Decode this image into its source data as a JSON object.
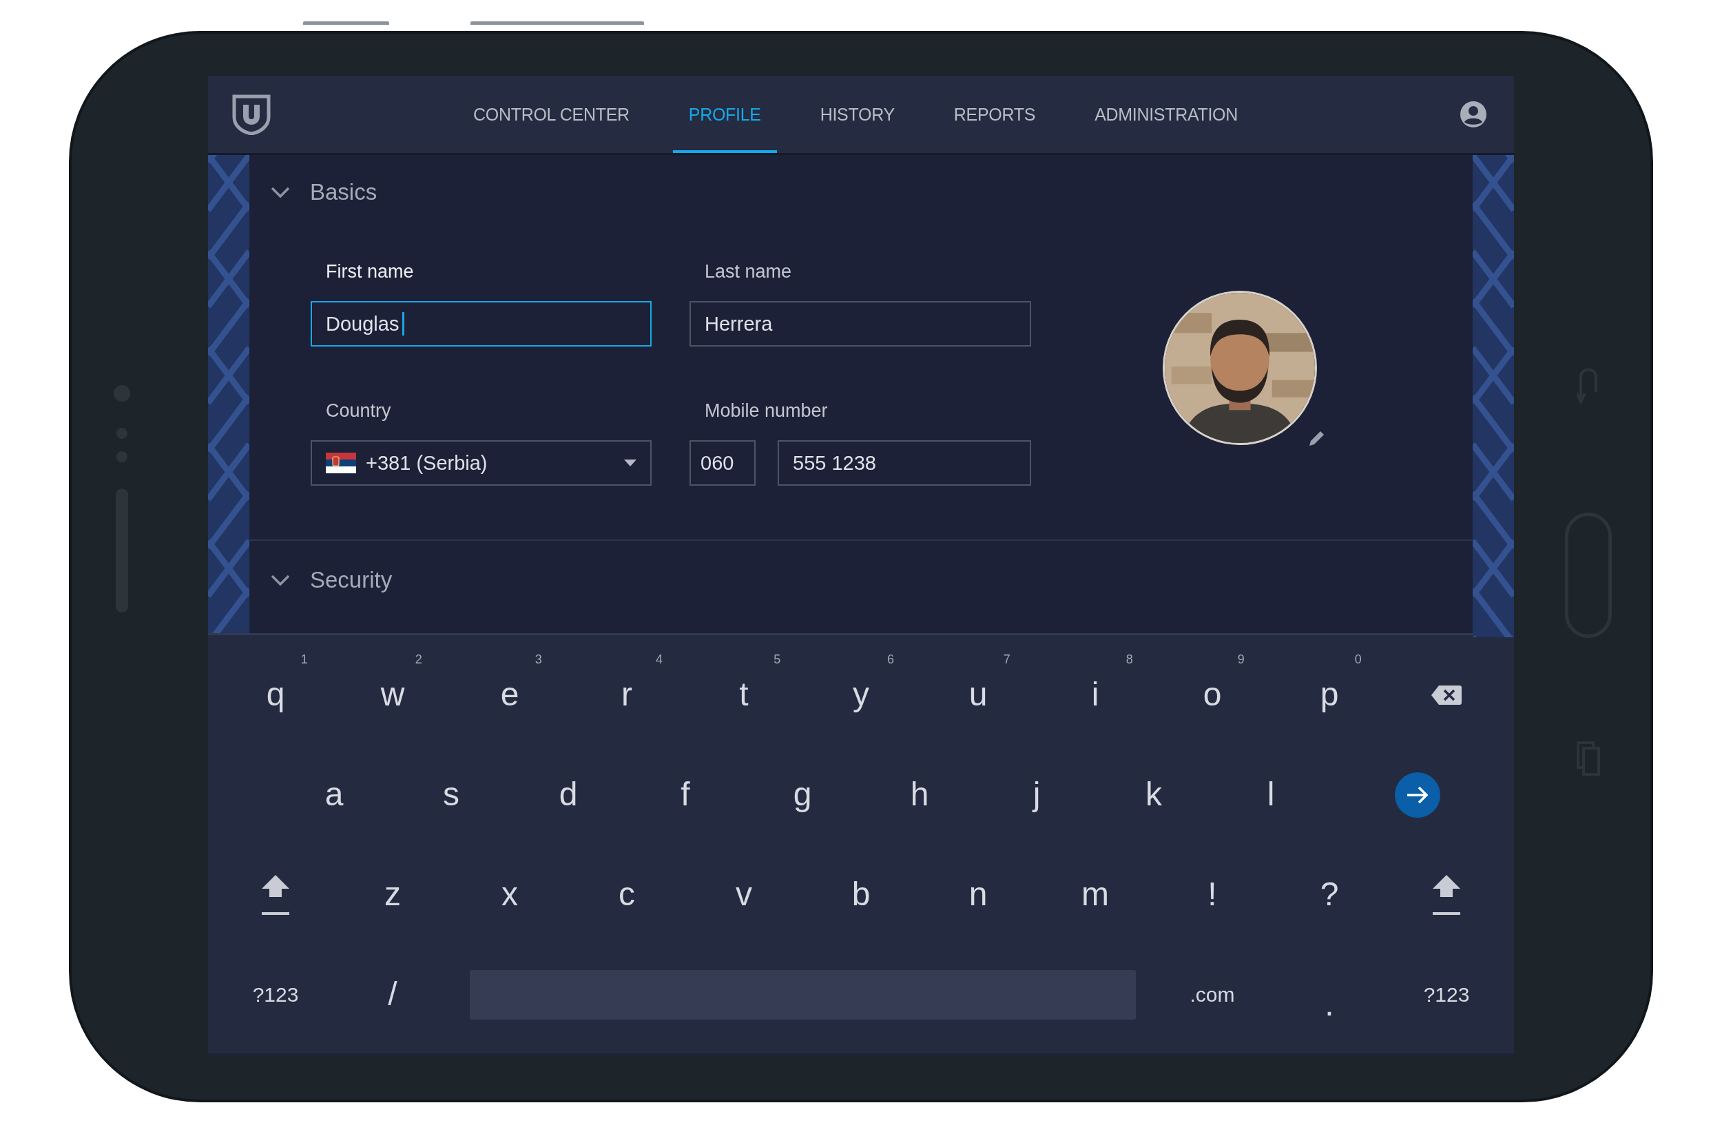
{
  "nav": {
    "tabs": [
      {
        "label": "CONTROL CENTER",
        "selected": false
      },
      {
        "label": "PROFILE",
        "selected": true
      },
      {
        "label": "HISTORY",
        "selected": false
      },
      {
        "label": "REPORTS",
        "selected": false
      },
      {
        "label": "ADMINISTRATION",
        "selected": false
      }
    ]
  },
  "basics": {
    "title": "Basics",
    "first_name": {
      "label": "First name",
      "value": "Douglas",
      "focused": true
    },
    "last_name": {
      "label": "Last name",
      "value": "Herrera",
      "focused": false
    },
    "country": {
      "label": "Country",
      "value": "+381 (Serbia)"
    },
    "mobile": {
      "label": "Mobile number",
      "prefix": "060",
      "number": "555 1238"
    }
  },
  "security": {
    "title": "Security"
  },
  "keyboard": {
    "rows": [
      [
        {
          "kind": "char",
          "label": "q",
          "hint": "1"
        },
        {
          "kind": "char",
          "label": "w",
          "hint": "2"
        },
        {
          "kind": "char",
          "label": "e",
          "hint": "3"
        },
        {
          "kind": "char",
          "label": "r",
          "hint": "4"
        },
        {
          "kind": "char",
          "label": "t",
          "hint": "5"
        },
        {
          "kind": "char",
          "label": "y",
          "hint": "6"
        },
        {
          "kind": "char",
          "label": "u",
          "hint": "7"
        },
        {
          "kind": "char",
          "label": "i",
          "hint": "8"
        },
        {
          "kind": "char",
          "label": "o",
          "hint": "9"
        },
        {
          "kind": "char",
          "label": "p",
          "hint": "0"
        },
        {
          "kind": "backspace"
        }
      ],
      [
        {
          "kind": "char",
          "label": "a"
        },
        {
          "kind": "char",
          "label": "s"
        },
        {
          "kind": "char",
          "label": "d"
        },
        {
          "kind": "char",
          "label": "f"
        },
        {
          "kind": "char",
          "label": "g"
        },
        {
          "kind": "char",
          "label": "h"
        },
        {
          "kind": "char",
          "label": "j"
        },
        {
          "kind": "char",
          "label": "k"
        },
        {
          "kind": "char",
          "label": "l"
        },
        {
          "kind": "enter"
        }
      ],
      [
        {
          "kind": "shift"
        },
        {
          "kind": "char",
          "label": "z"
        },
        {
          "kind": "char",
          "label": "x"
        },
        {
          "kind": "char",
          "label": "c"
        },
        {
          "kind": "char",
          "label": "v"
        },
        {
          "kind": "char",
          "label": "b"
        },
        {
          "kind": "char",
          "label": "n"
        },
        {
          "kind": "char",
          "label": "m"
        },
        {
          "kind": "char",
          "label": "!"
        },
        {
          "kind": "char",
          "label": "?"
        },
        {
          "kind": "shift"
        }
      ]
    ],
    "bottom_row": [
      {
        "kind": "mode",
        "label": "?123"
      },
      {
        "kind": "char",
        "label": "/"
      },
      {
        "kind": "space"
      },
      {
        "kind": "mode",
        "label": ".com"
      },
      {
        "kind": "char",
        "label": "."
      },
      {
        "kind": "mode",
        "label": "?123"
      }
    ]
  }
}
